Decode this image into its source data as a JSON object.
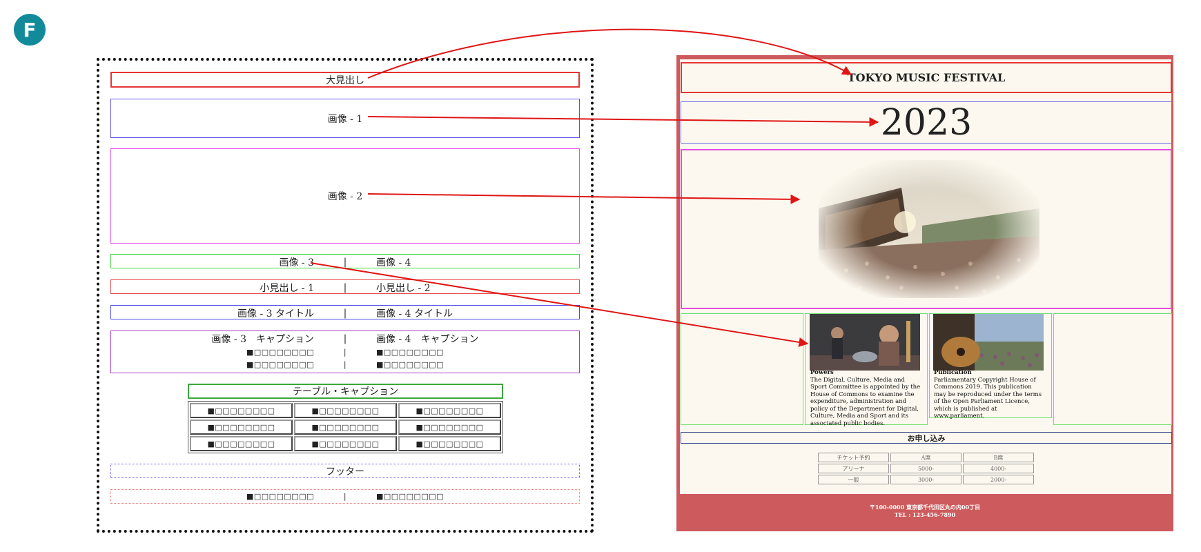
{
  "badge": "F",
  "wireframe": {
    "heading": "大見出し",
    "image1": "画像 - 1",
    "image2": "画像 - 2",
    "image3": "画像 - 3",
    "image4": "画像 - 4",
    "sep": "|",
    "subheading1": "小見出し - 1",
    "subheading2": "小見出し - 2",
    "image3_title": "画像 - 3 タイトル",
    "image4_title": "画像 - 4 タイトル",
    "image3_caption": "画像 - 3　キャプション",
    "image4_caption": "画像 - 4　キャプション",
    "placeholder": "■□□□□□□□□",
    "table_caption": "テーブル・キャプション",
    "table_rows": [
      [
        "■□□□□□□□□",
        "■□□□□□□□□",
        "■□□□□□□□□"
      ],
      [
        "■□□□□□□□□",
        "■□□□□□□□□",
        "■□□□□□□□□"
      ],
      [
        "■□□□□□□□□",
        "■□□□□□□□□",
        "■□□□□□□□□"
      ]
    ],
    "footer": "フッター"
  },
  "site": {
    "title": "TOKYO MUSIC FESTIVAL",
    "year": "2023",
    "col1": {
      "title": "Powers",
      "body": "The Digital, Culture, Media and Sport Committee is appointed by the House of Commons to examine the expenditure, administration and policy of the Department for Digital, Culture, Media and Sport and its associated public bodies."
    },
    "col2": {
      "title": "Publication",
      "body": "Parliamentary Copyright House of Commons 2019. This publication may be reproduced under the terms of the Open Parliament Licence, which is published at www.parliament."
    },
    "apply": "お申し込み",
    "ticket_table": [
      [
        "チケット予約",
        "A席",
        "B席"
      ],
      [
        "アリーナ",
        "5000-",
        "4000-"
      ],
      [
        "一般",
        "3000-",
        "2000-"
      ]
    ],
    "footer_address": "〒100-0000 東京都千代田区丸の内00丁目",
    "footer_tel": "TEL : 123-456-7890"
  },
  "colors": {
    "badge": "#128a9a",
    "site_frame": "#cd5a5c",
    "site_bg": "#fcf8ef",
    "arrow": "#e01515"
  }
}
